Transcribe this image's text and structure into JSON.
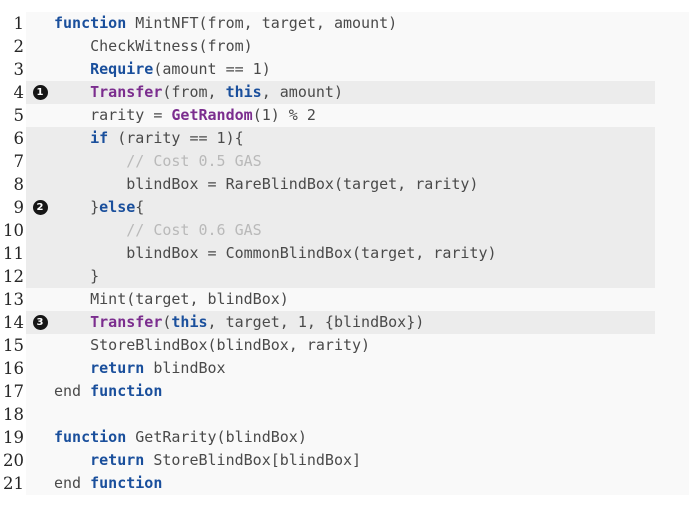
{
  "code_block": {
    "language": "pseudocode",
    "colors": {
      "background": "#f9f9f9",
      "highlight": "#ececec",
      "keyword": "#1a4f9c",
      "function": "#7b2d8e",
      "comment": "#b9b9b9",
      "plain": "#4a4a4a",
      "line_number": "#262626",
      "marker_fill": "#161616",
      "marker_text": "#ffffff"
    },
    "lines": [
      {
        "number": "1",
        "marker": "",
        "highlighted": false,
        "tokens": [
          {
            "t": "function",
            "c": "kw"
          },
          {
            "t": " MintNFT(from, target, amount)",
            "c": "pl"
          }
        ]
      },
      {
        "number": "2",
        "marker": "",
        "highlighted": false,
        "tokens": [
          {
            "t": "    CheckWitness(from)",
            "c": "pl"
          }
        ]
      },
      {
        "number": "3",
        "marker": "",
        "highlighted": false,
        "tokens": [
          {
            "t": "    ",
            "c": "pl"
          },
          {
            "t": "Require",
            "c": "kw"
          },
          {
            "t": "(amount == 1)",
            "c": "pl"
          }
        ]
      },
      {
        "number": "4",
        "marker": "1",
        "highlighted": true,
        "tokens": [
          {
            "t": "    ",
            "c": "pl"
          },
          {
            "t": "Transfer",
            "c": "fn"
          },
          {
            "t": "(from, ",
            "c": "pl"
          },
          {
            "t": "this",
            "c": "kw"
          },
          {
            "t": ", amount)",
            "c": "pl"
          }
        ]
      },
      {
        "number": "5",
        "marker": "",
        "highlighted": false,
        "tokens": [
          {
            "t": "    rarity = ",
            "c": "pl"
          },
          {
            "t": "GetRandom",
            "c": "fn"
          },
          {
            "t": "(1) % 2",
            "c": "pl"
          }
        ]
      },
      {
        "number": "6",
        "marker": "",
        "highlighted": true,
        "tokens": [
          {
            "t": "    ",
            "c": "pl"
          },
          {
            "t": "if",
            "c": "kw"
          },
          {
            "t": " (rarity == 1){",
            "c": "pl"
          }
        ]
      },
      {
        "number": "7",
        "marker": "",
        "highlighted": true,
        "tokens": [
          {
            "t": "        // Cost 0.5 GAS",
            "c": "cmt"
          }
        ]
      },
      {
        "number": "8",
        "marker": "",
        "highlighted": true,
        "tokens": [
          {
            "t": "        blindBox = RareBlindBox(target, rarity)",
            "c": "pl"
          }
        ]
      },
      {
        "number": "9",
        "marker": "2",
        "highlighted": true,
        "tokens": [
          {
            "t": "    }",
            "c": "pl"
          },
          {
            "t": "else",
            "c": "kw"
          },
          {
            "t": "{",
            "c": "pl"
          }
        ]
      },
      {
        "number": "10",
        "marker": "",
        "highlighted": true,
        "tokens": [
          {
            "t": "        // Cost 0.6 GAS",
            "c": "cmt"
          }
        ]
      },
      {
        "number": "11",
        "marker": "",
        "highlighted": true,
        "tokens": [
          {
            "t": "        blindBox = CommonBlindBox(target, rarity)",
            "c": "pl"
          }
        ]
      },
      {
        "number": "12",
        "marker": "",
        "highlighted": true,
        "tokens": [
          {
            "t": "    }",
            "c": "pl"
          }
        ]
      },
      {
        "number": "13",
        "marker": "",
        "highlighted": false,
        "tokens": [
          {
            "t": "    Mint(target, blindBox)",
            "c": "pl"
          }
        ]
      },
      {
        "number": "14",
        "marker": "3",
        "highlighted": true,
        "tokens": [
          {
            "t": "    ",
            "c": "pl"
          },
          {
            "t": "Transfer",
            "c": "fn"
          },
          {
            "t": "(",
            "c": "pl"
          },
          {
            "t": "this",
            "c": "kw"
          },
          {
            "t": ", target, 1, {blindBox})",
            "c": "pl"
          }
        ]
      },
      {
        "number": "15",
        "marker": "",
        "highlighted": false,
        "tokens": [
          {
            "t": "    StoreBlindBox(blindBox, rarity)",
            "c": "pl"
          }
        ]
      },
      {
        "number": "16",
        "marker": "",
        "highlighted": false,
        "tokens": [
          {
            "t": "    ",
            "c": "pl"
          },
          {
            "t": "return",
            "c": "kw"
          },
          {
            "t": " blindBox",
            "c": "pl"
          }
        ]
      },
      {
        "number": "17",
        "marker": "",
        "highlighted": false,
        "tokens": [
          {
            "t": "end ",
            "c": "pl"
          },
          {
            "t": "function",
            "c": "kw"
          }
        ]
      },
      {
        "number": "18",
        "marker": "",
        "highlighted": false,
        "tokens": [
          {
            "t": "",
            "c": "pl"
          }
        ]
      },
      {
        "number": "19",
        "marker": "",
        "highlighted": false,
        "tokens": [
          {
            "t": "function",
            "c": "kw"
          },
          {
            "t": " GetRarity(blindBox)",
            "c": "pl"
          }
        ]
      },
      {
        "number": "20",
        "marker": "",
        "highlighted": false,
        "tokens": [
          {
            "t": "    ",
            "c": "pl"
          },
          {
            "t": "return",
            "c": "kw"
          },
          {
            "t": " StoreBlindBox[blindBox]",
            "c": "pl"
          }
        ]
      },
      {
        "number": "21",
        "marker": "",
        "highlighted": false,
        "tokens": [
          {
            "t": "end ",
            "c": "pl"
          },
          {
            "t": "function",
            "c": "kw"
          }
        ]
      }
    ]
  }
}
